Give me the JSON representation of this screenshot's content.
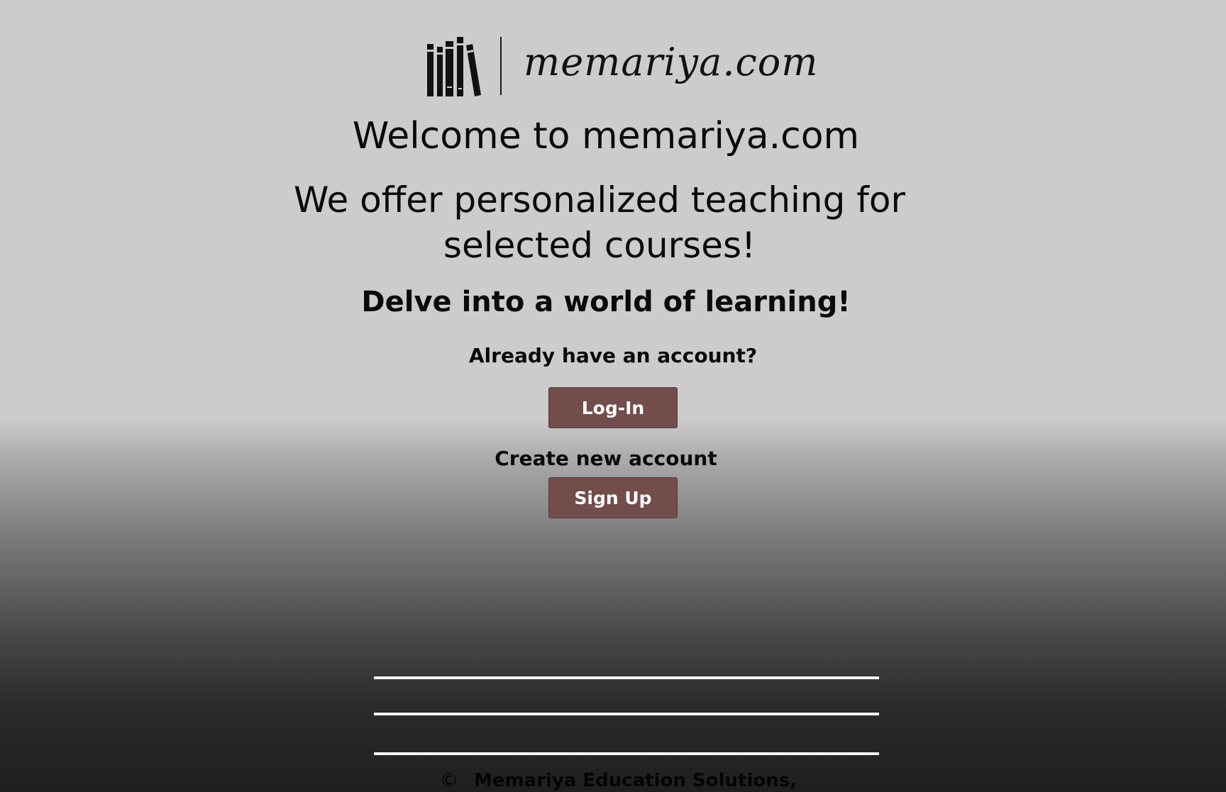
{
  "logo": {
    "brand_text": "memariya.com",
    "icon": "books-icon"
  },
  "hero": {
    "welcome": "Welcome to memariya.com",
    "offer_line1": "We offer personalized teaching  for",
    "offer_line2": "selected courses!",
    "tagline": "Delve into  a world of learning!"
  },
  "account": {
    "existing_prompt": "Already have an account?",
    "login_label": "Log-In",
    "create_prompt": "Create new account",
    "signup_label": "Sign Up"
  },
  "footer": {
    "copyright_symbol": "©",
    "copyright_text": "Memariya Education Solutions,"
  },
  "colors": {
    "button_bg": "#734c4c",
    "button_text": "#ffffff",
    "page_top": "#cccccc",
    "page_bottom": "#1f1e20"
  }
}
